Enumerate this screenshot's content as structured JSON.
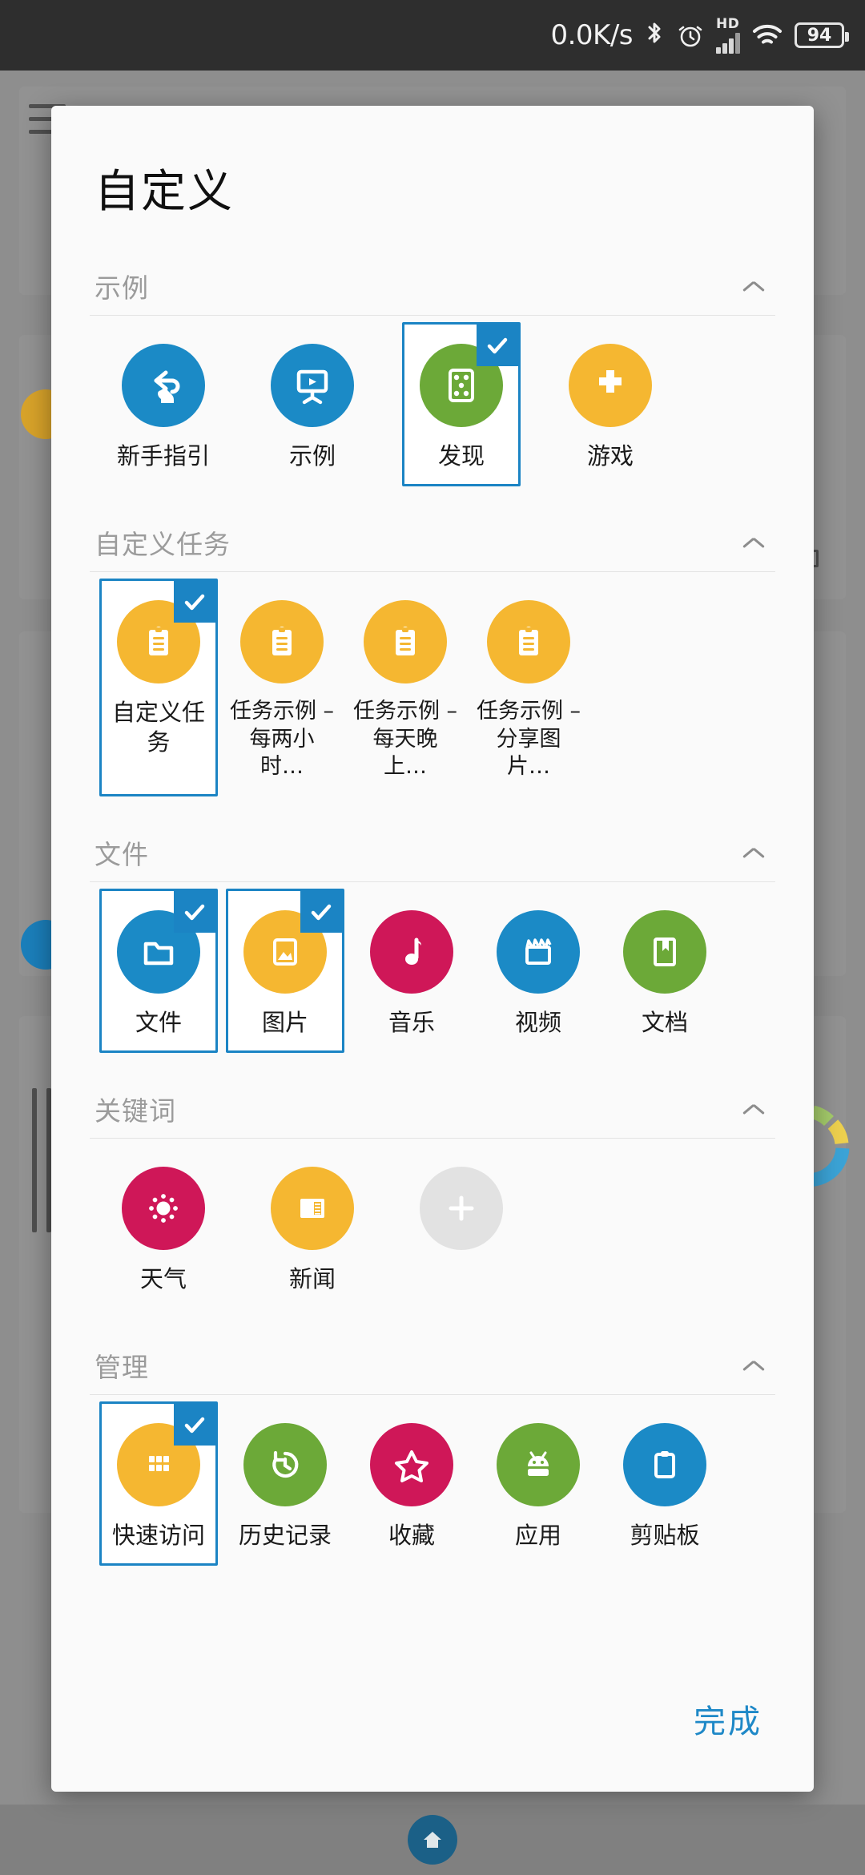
{
  "statusbar": {
    "net_speed": "0.0K/s",
    "hd_label": "HD",
    "battery_level": "94",
    "icons": [
      "bluetooth-icon",
      "alarm-icon",
      "signal-icon",
      "wifi-icon",
      "battery-icon"
    ]
  },
  "dialog": {
    "title": "自定义",
    "done_label": "完成",
    "accent_color": "#1b84c4",
    "sections": [
      {
        "title": "示例",
        "collapse_icon": "chevron-up-icon",
        "items": [
          {
            "label": "新手指引",
            "icon": "guide-hand-icon",
            "color": "#1b8ac6",
            "selected": false
          },
          {
            "label": "示例",
            "icon": "presentation-icon",
            "color": "#1b8ac6",
            "selected": false
          },
          {
            "label": "发现",
            "icon": "dice-icon",
            "color": "#6ca938",
            "selected": true
          },
          {
            "label": "游戏",
            "icon": "gamepad-icon",
            "color": "#f5b731",
            "selected": false
          }
        ]
      },
      {
        "title": "自定义任务",
        "collapse_icon": "chevron-up-icon",
        "items": [
          {
            "label": "自定义任务",
            "icon": "clipboard-task-icon",
            "color": "#f5b731",
            "selected": true
          },
          {
            "label": "任务示例 – 每两小时…",
            "icon": "clipboard-task-icon",
            "color": "#f5b731",
            "selected": false
          },
          {
            "label": "任务示例 – 每天晚上…",
            "icon": "clipboard-task-icon",
            "color": "#f5b731",
            "selected": false
          },
          {
            "label": "任务示例 – 分享图片…",
            "icon": "clipboard-task-icon",
            "color": "#f5b731",
            "selected": false
          }
        ]
      },
      {
        "title": "文件",
        "collapse_icon": "chevron-up-icon",
        "items": [
          {
            "label": "文件",
            "icon": "folder-icon",
            "color": "#1b8ac6",
            "selected": true
          },
          {
            "label": "图片",
            "icon": "image-icon",
            "color": "#f5b731",
            "selected": true
          },
          {
            "label": "音乐",
            "icon": "music-note-icon",
            "color": "#cf1758",
            "selected": false
          },
          {
            "label": "视频",
            "icon": "clapperboard-icon",
            "color": "#1b8ac6",
            "selected": false
          },
          {
            "label": "文档",
            "icon": "book-icon",
            "color": "#6ca938",
            "selected": false
          }
        ]
      },
      {
        "title": "关键词",
        "collapse_icon": "chevron-up-icon",
        "items": [
          {
            "label": "天气",
            "icon": "sun-icon",
            "color": "#cf1758",
            "selected": false
          },
          {
            "label": "新闻",
            "icon": "newspaper-icon",
            "color": "#f5b731",
            "selected": false
          },
          {
            "label": "",
            "icon": "plus-icon",
            "color": "#e2e2e2",
            "selected": false
          }
        ]
      },
      {
        "title": "管理",
        "collapse_icon": "chevron-up-icon",
        "items": [
          {
            "label": "快速访问",
            "icon": "grid-icon",
            "color": "#f5b731",
            "selected": true
          },
          {
            "label": "历史记录",
            "icon": "history-icon",
            "color": "#6ca938",
            "selected": false
          },
          {
            "label": "收藏",
            "icon": "star-icon",
            "color": "#cf1758",
            "selected": false
          },
          {
            "label": "应用",
            "icon": "android-icon",
            "color": "#6ca938",
            "selected": false
          },
          {
            "label": "剪贴板",
            "icon": "clipboard-icon",
            "color": "#1b8ac6",
            "selected": false
          }
        ]
      }
    ]
  },
  "navbar": {
    "home_icon": "home-icon"
  },
  "floating": {
    "widget_icon": "color-ring-icon"
  }
}
